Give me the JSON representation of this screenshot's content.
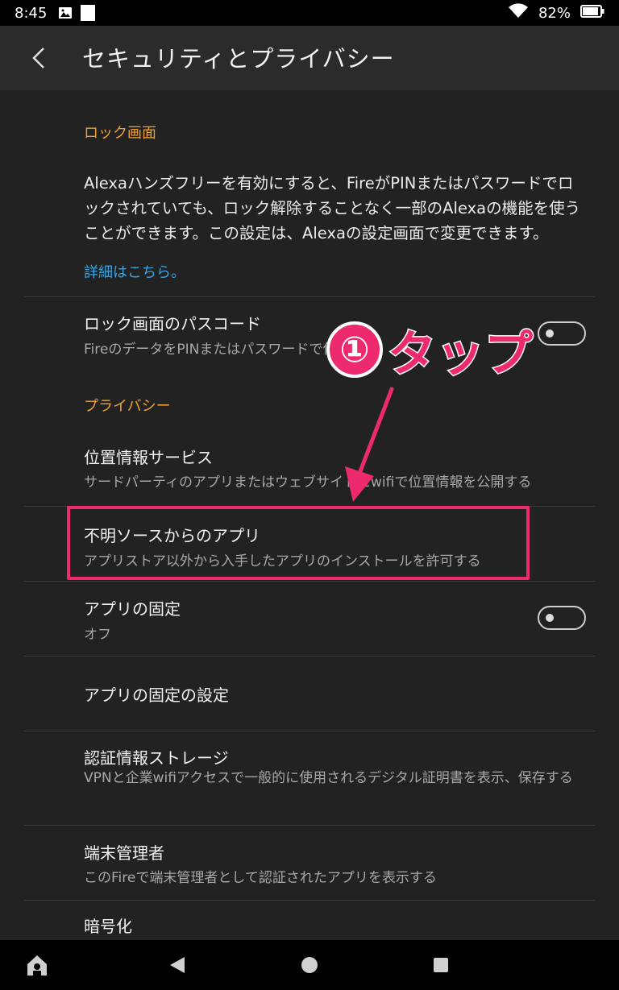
{
  "status_bar": {
    "time": "8:45",
    "battery": "82%"
  },
  "app_bar": {
    "title": "セキュリティとプライバシー"
  },
  "lock_screen": {
    "header": "ロック画面",
    "description_lines": [
      "Alexaハンズフリーを有効にすると、FireがPINまたはパスワードでロ",
      "ックされていても、ロック解除することなく一部のAlexaの機能を使う",
      "ことができます。この設定は、Alexaの設定画面で変更できます。"
    ],
    "link": "詳細はこちら。",
    "passcode": {
      "title": "ロック画面のパスコード",
      "subtitle": "FireのデータをPINまたはパスワードで保護"
    }
  },
  "privacy": {
    "header": "プライバシー",
    "items": [
      {
        "title": "位置情報サービス",
        "subtitle": "サードパーティのアプリまたはウェブサイトにwifiで位置情報を公開する"
      },
      {
        "title": "不明ソースからのアプリ",
        "subtitle": "アプリストア以外から入手したアプリのインストールを許可する"
      },
      {
        "title": "アプリの固定",
        "subtitle": "オフ"
      },
      {
        "title": "アプリの固定の設定",
        "subtitle": ""
      },
      {
        "title": "認証情報ストレージ",
        "subtitle": "VPNと企業wifiアクセスで一般的に使用されるデジタル証明書を表示、保存する"
      },
      {
        "title": "端末管理者",
        "subtitle": "このFireで端末管理者として認証されたアプリを表示する"
      },
      {
        "title": "暗号化",
        "subtitle": ""
      }
    ]
  },
  "annotation": {
    "number": "①",
    "text": "タップ",
    "color": "#ee2a6e"
  },
  "colors": {
    "accent_orange": "#f0a030",
    "link_blue": "#3aa3e0",
    "background": "#222222"
  },
  "icons": {
    "status_left": [
      "image-icon",
      "notification-square-icon"
    ],
    "status_right": [
      "wifi-icon",
      "battery-icon"
    ],
    "nav": [
      "home-icon",
      "back-triangle-icon",
      "home-circle-icon",
      "recents-square-icon"
    ]
  }
}
